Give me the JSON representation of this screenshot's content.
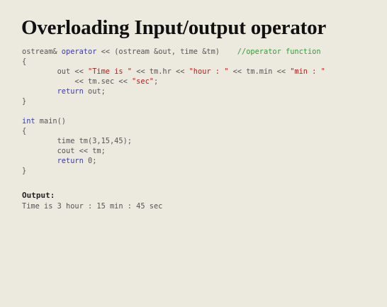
{
  "slide": {
    "title": "Overloading Input/output operator"
  },
  "code": {
    "line1": {
      "a": "ostream& ",
      "kw": "operator",
      "b": " << (ostream &out, time &tm)    ",
      "comment": "//operator function"
    },
    "line2": "{",
    "line3": {
      "a": "        out << ",
      "s1": "\"Time is \"",
      "b": " << tm.hr << ",
      "s2": "\"hour : \"",
      "c": " << tm.min << ",
      "s3": "\"min : \""
    },
    "line4": {
      "a": "            << tm.sec << ",
      "s1": "\"sec\"",
      "b": ";"
    },
    "line5": {
      "a": "        ",
      "kw": "return",
      "b": " out;"
    },
    "line6": "}",
    "line8": {
      "kw": "int",
      "b": " main()"
    },
    "line9": "{",
    "line10": "        time tm(3,15,45);",
    "line11": "        cout << tm;",
    "line12": {
      "a": "        ",
      "kw": "return",
      "b": " 0;"
    },
    "line13": "}"
  },
  "output": {
    "label": "Output:",
    "text": "Time is 3 hour : 15 min : 45 sec"
  }
}
